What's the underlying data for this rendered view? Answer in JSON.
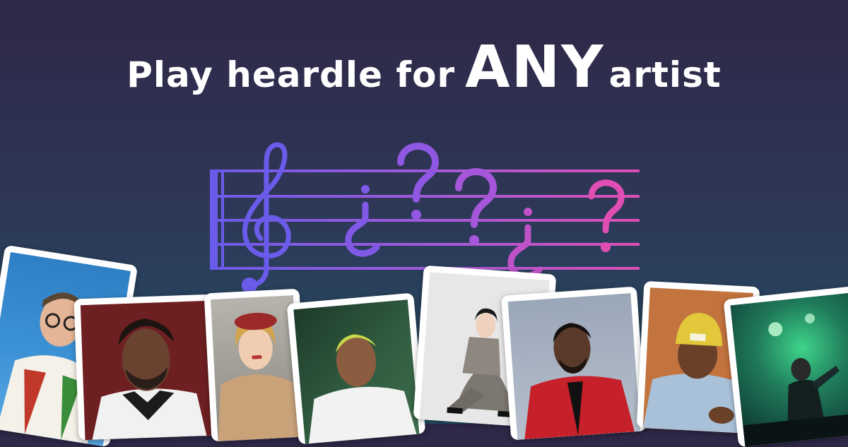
{
  "banner": {
    "headline_prefix": "Play heardle for",
    "headline_emphasis": "ANY",
    "headline_suffix": "artist"
  },
  "colors": {
    "background_top": "#2f2747",
    "background_bottom": "#234f66",
    "staff_gradient_start": "#6b5bea",
    "staff_gradient_end": "#e04eb3",
    "headline": "#ffffff",
    "card_frame": "#ffffff"
  },
  "staff_symbols": [
    "treble-clef",
    "inverted-question-mark",
    "question-mark",
    "question-mark",
    "inverted-question-mark",
    "question-mark"
  ],
  "artist_photos": [
    {
      "name": "artist-photo-1",
      "icon": "person-in-floral-shirt-photo"
    },
    {
      "name": "artist-photo-2",
      "icon": "person-with-bandana-photo"
    },
    {
      "name": "artist-photo-3",
      "icon": "person-in-red-beret-photo"
    },
    {
      "name": "artist-photo-4",
      "icon": "person-in-white-sweater-photo"
    },
    {
      "name": "artist-photo-5",
      "icon": "person-seated-in-grey-suit-photo"
    },
    {
      "name": "artist-photo-6",
      "icon": "person-in-red-suit-photo"
    },
    {
      "name": "artist-photo-7",
      "icon": "person-in-yellow-beanie-photo"
    },
    {
      "name": "artist-photo-8",
      "icon": "performer-on-stage-photo"
    }
  ]
}
